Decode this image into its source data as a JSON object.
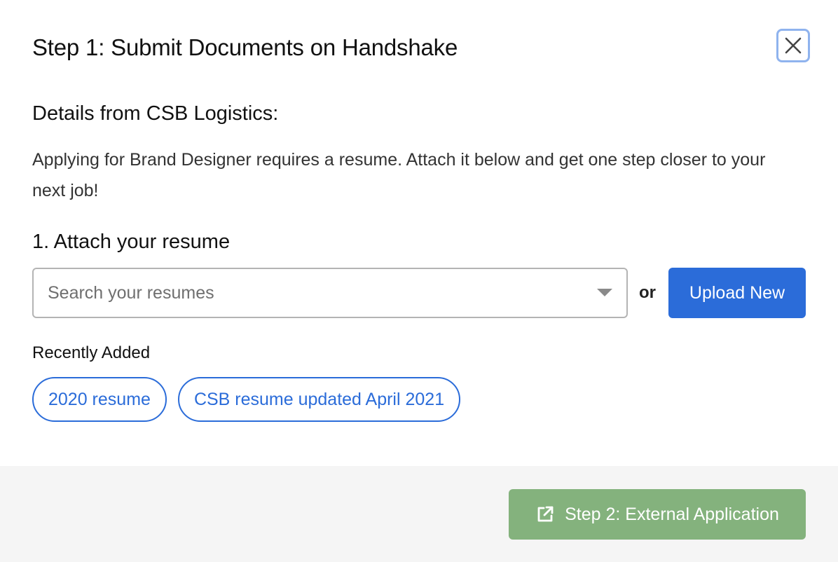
{
  "modal": {
    "title": "Step 1: Submit Documents on Handshake",
    "close_icon": "close-icon"
  },
  "details": {
    "heading": "Details from CSB Logistics:",
    "description": "Applying for Brand Designer requires a resume. Attach it below and get one step closer to your next job!"
  },
  "attach": {
    "heading": "1. Attach your resume",
    "search_placeholder": "Search your resumes",
    "search_value": "",
    "dropdown_icon": "chevron-down-icon",
    "or_label": "or",
    "upload_label": "Upload New"
  },
  "recent": {
    "label": "Recently Added",
    "items": [
      "2020 resume",
      "CSB resume updated April 2021"
    ]
  },
  "footer": {
    "step2_label": "Step 2: External Application",
    "step2_icon": "external-link-icon"
  },
  "colors": {
    "primary": "#2b6cd9",
    "success_disabled": "#84b27d",
    "footer_bg": "#f5f5f5",
    "focus_ring": "#8fb3ee"
  }
}
